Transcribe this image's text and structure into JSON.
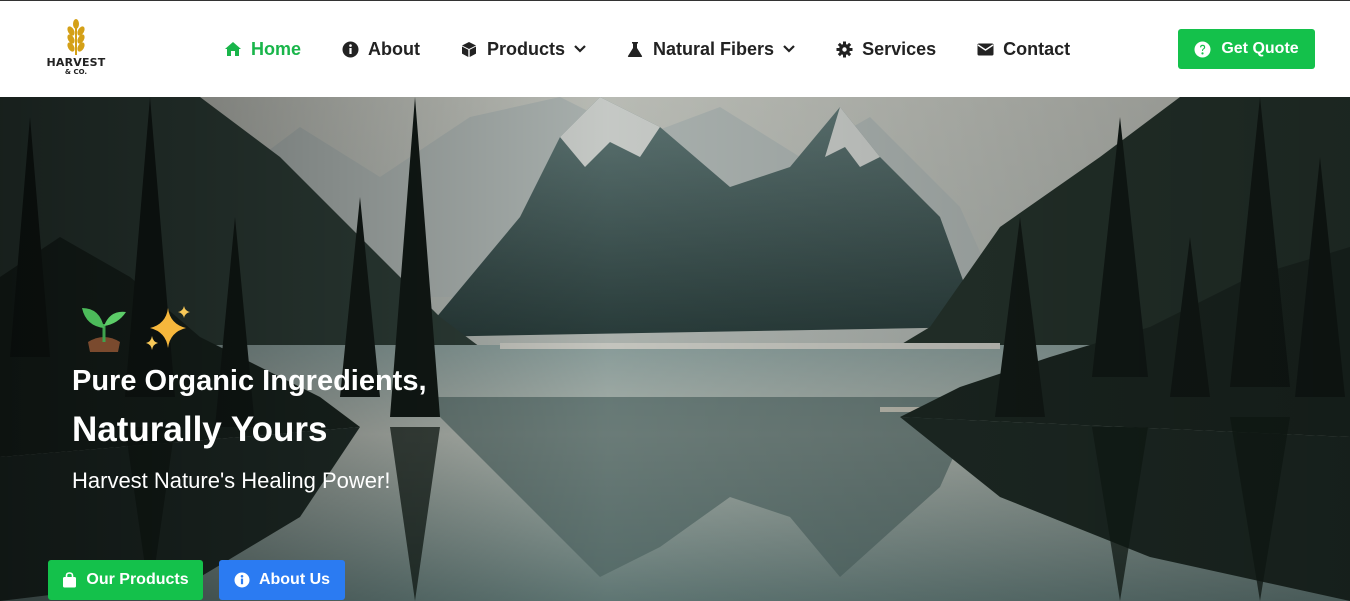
{
  "brand": {
    "line1": "HARVEST",
    "line2": "& CO."
  },
  "nav": {
    "items": [
      {
        "label": "Home",
        "icon": "home-icon",
        "active": true
      },
      {
        "label": "About",
        "icon": "info-icon"
      },
      {
        "label": "Products",
        "icon": "box-icon",
        "dropdown": true
      },
      {
        "label": "Natural Fibers",
        "icon": "flask-icon",
        "dropdown": true
      },
      {
        "label": "Services",
        "icon": "gear-icon"
      },
      {
        "label": "Contact",
        "icon": "envelope-icon"
      }
    ],
    "cta_label": "Get Quote"
  },
  "hero": {
    "emojis": [
      "seedling-icon",
      "sparkles-icon"
    ],
    "headline_1": "Pure Organic Ingredients,",
    "headline_2": "Naturally Yours",
    "subtitle": "Harvest Nature's Healing Power!",
    "primary_button": "Our Products",
    "secondary_button": "About Us"
  },
  "colors": {
    "accent_green": "#14c14b",
    "accent_blue": "#2b7bf2",
    "active_nav": "#19b54a",
    "wheat_gold": "#d4a017"
  }
}
